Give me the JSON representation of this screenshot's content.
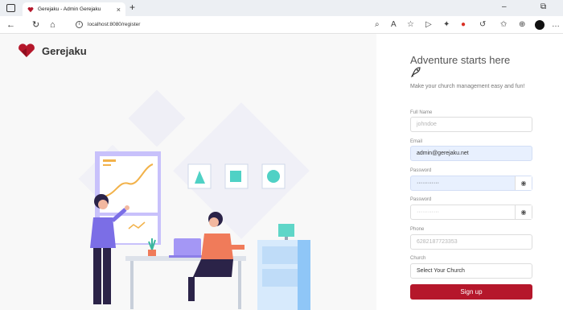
{
  "browser": {
    "tab_title": "Gerejaku - Admin Gerejaku",
    "tab_close": "×",
    "new_tab": "+",
    "url": "localhost:8080/register"
  },
  "brand": {
    "name": "Gerejaku",
    "color": "#b5172b"
  },
  "form": {
    "heading": "Adventure starts here",
    "subtitle": "Make your church management easy and fun!",
    "fields": [
      {
        "label": "Full Name",
        "placeholder": "johndoe",
        "value": ""
      },
      {
        "label": "Email",
        "placeholder": "",
        "value": "admin@gerejaku.net"
      },
      {
        "label": "Password",
        "placeholder": "",
        "value": "············"
      },
      {
        "label": "Password",
        "placeholder": "············",
        "value": ""
      },
      {
        "label": "Phone",
        "placeholder": "6282187723353",
        "value": ""
      },
      {
        "label": "Church",
        "placeholder": "",
        "value": "Select Your Church"
      }
    ],
    "submit_label": "Sign up"
  },
  "colors": {
    "accent": "#b5172b",
    "autofill": "#e8f0fe",
    "illustration": "#7b6ee6"
  }
}
